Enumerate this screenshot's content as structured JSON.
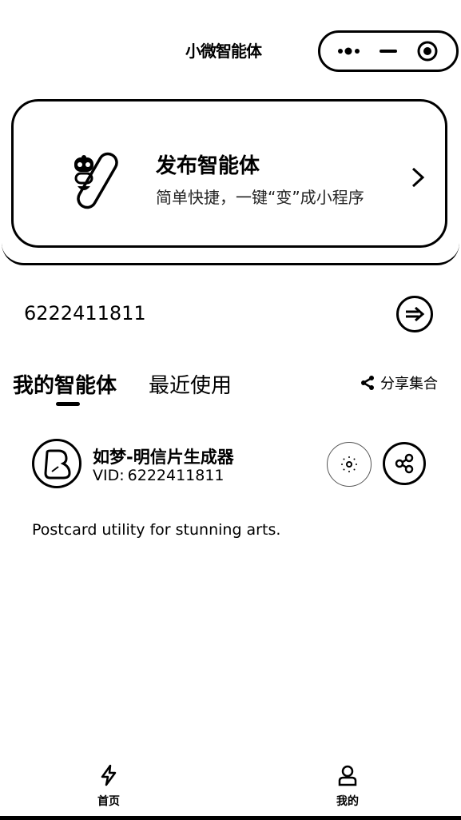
{
  "header": {
    "title": "小微智能体",
    "capsule": {
      "more_icon": "more-dots-icon",
      "minimize_icon": "minimize-icon",
      "close_icon": "target-circle-icon"
    }
  },
  "publish_card": {
    "title": "发布智能体",
    "subtitle": "简单快捷，一键“变”成小程序",
    "icon": "robot-capsule-icon",
    "chevron": "chevron-right-icon"
  },
  "id_row": {
    "value": "6222411811",
    "enter_icon": "arrow-enter-icon"
  },
  "tabs": {
    "mine": "我的智能体",
    "recent": "最近使用",
    "share_set": "分享集合",
    "share_icon": "share-icon"
  },
  "agents": [
    {
      "name": "如梦-明信片生成器",
      "vid_label": "VID:",
      "vid": "6222411811",
      "description": "Postcard utility for stunning arts.",
      "avatar_icon": "avatar-icon",
      "settings_icon": "settings-icon",
      "share_icon": "share-icon"
    }
  ],
  "bottom_nav": {
    "home_label": "首页",
    "me_label": "我的",
    "home_icon": "lightning-icon",
    "me_icon": "user-icon"
  }
}
